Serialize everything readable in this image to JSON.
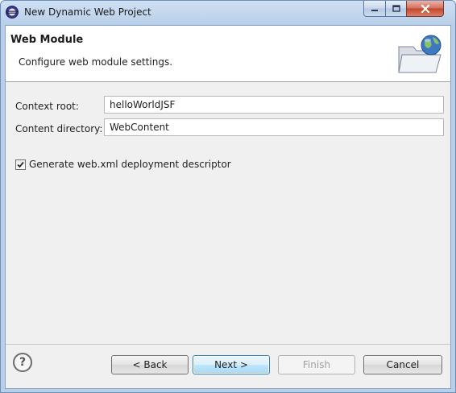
{
  "window": {
    "title": "New Dynamic Web Project"
  },
  "banner": {
    "title": "Web Module",
    "description": "Configure web module settings.",
    "icon": "web-project-folder-globe-icon"
  },
  "form": {
    "context_root_label": "Context root:",
    "context_root_value": "helloWorldJSF",
    "content_directory_label": "Content directory:",
    "content_directory_value": "WebContent",
    "generate_descriptor_label": "Generate web.xml deployment descriptor",
    "generate_descriptor_checked": true
  },
  "buttons": {
    "help": "?",
    "back": "< Back",
    "next": "Next >",
    "finish": "Finish",
    "cancel": "Cancel"
  }
}
